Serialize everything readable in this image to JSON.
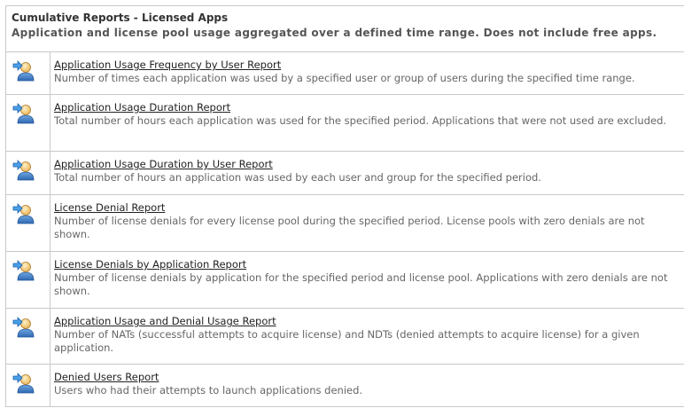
{
  "header": {
    "title": "Cumulative Reports - Licensed Apps",
    "subtitle": "Application and license pool usage aggregated over a defined time range. Does not include free apps."
  },
  "reports": [
    {
      "title": "Application Usage Frequency by User Report",
      "description": "Number of times each application was used by a specified user or group of users during the specified time range.",
      "icon": "user-arrow-icon"
    },
    {
      "title": "Application Usage Duration Report",
      "description": "Total number of hours each application was used for the specified period. Applications that were not used are excluded.",
      "icon": "user-arrow-icon"
    },
    {
      "title": "Application Usage Duration by User Report",
      "description": "Total number of hours an application was used by each user and group for the specified period.",
      "icon": "user-arrow-icon"
    },
    {
      "title": "License Denial Report",
      "description": "Number of license denials for every license pool during the specified period. License pools with zero denials are not shown.",
      "icon": "user-arrow-icon"
    },
    {
      "title": "License Denials by Application Report",
      "description": "Number of license denials by application for the specified period and license pool. Applications with zero denials are not shown.",
      "icon": "user-arrow-icon"
    },
    {
      "title": "Application Usage and Denial Usage Report",
      "description": "Number of NATs (successful attempts to acquire license) and NDTs (denied attempts to acquire license) for a given application.",
      "icon": "user-arrow-icon"
    },
    {
      "title": "Denied Users Report",
      "description": "Users who had their attempts to launch applications denied.",
      "icon": "user-arrow-icon"
    }
  ]
}
